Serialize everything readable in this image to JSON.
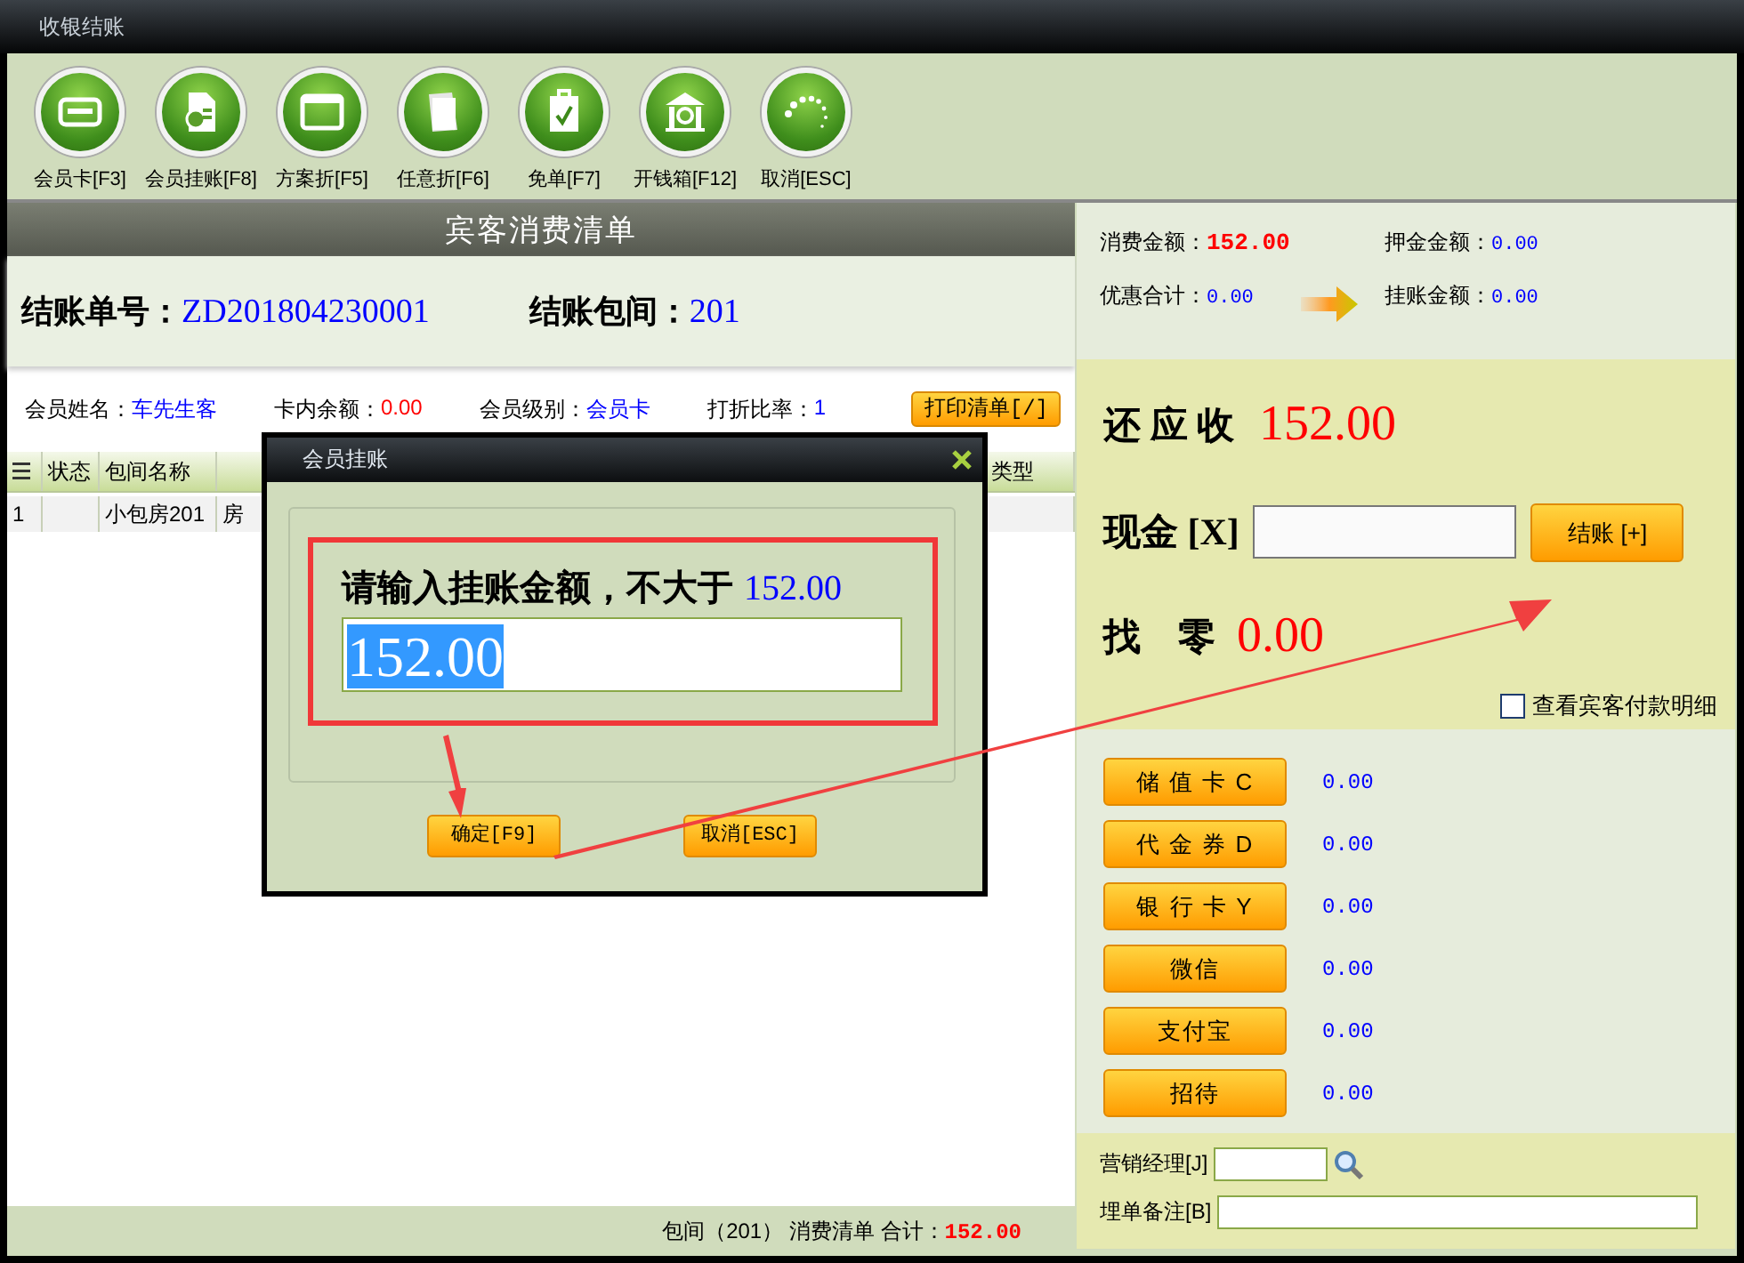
{
  "window": {
    "title": "收银结账"
  },
  "toolbar": [
    {
      "label": "会员卡[F3]",
      "kind": "card"
    },
    {
      "label": "会员挂账[F8]",
      "kind": "document"
    },
    {
      "label": "方案折[F5]",
      "kind": "window"
    },
    {
      "label": "任意折[F6]",
      "kind": "papers"
    },
    {
      "label": "免单[F7]",
      "kind": "clipboard"
    },
    {
      "label": "开钱箱[F12]",
      "kind": "building"
    },
    {
      "label": "取消[ESC]",
      "kind": "dots"
    }
  ],
  "bill": {
    "title": "宾客消费清单",
    "number_label": "结账单号：",
    "number": "ZD201804230001",
    "room_label": "结账包间：",
    "room": "201",
    "member": [
      {
        "label": "会员姓名：",
        "value": "车先生客",
        "color": "#0000ff"
      },
      {
        "label": "卡内余额：",
        "value": "0.00",
        "color": "#ff0000"
      },
      {
        "label": "会员级别：",
        "value": "会员卡",
        "color": "#0000ff"
      },
      {
        "label": "打折比率：",
        "value": "1",
        "color": "#0000ff"
      }
    ],
    "print_button": "打印清单[/]",
    "table": {
      "columns": [
        {
          "label": "状态"
        },
        {
          "label": "包间名称"
        },
        {
          "label": "类型"
        }
      ],
      "rows": [
        {
          "number": "1",
          "room_name": "小包房201",
          "column_4": "房"
        }
      ]
    },
    "footer": {
      "text": "包间（201） 消费清单 合计：",
      "total": "152.00"
    }
  },
  "summary": [
    {
      "label": "消费金额：",
      "value": "152.00",
      "color": "#ff0000"
    },
    {
      "label": "押金金额：",
      "value": "0.00",
      "color": "#0000ff"
    },
    {
      "label": "优惠合计：",
      "value": "0.00",
      "color": "#0000ff"
    },
    {
      "label": "挂账金额：",
      "value": "0.00",
      "color": "#0000ff"
    }
  ],
  "due": {
    "label": "还 应 收",
    "value": "152.00"
  },
  "cash": {
    "label": "现金 [X]",
    "button": "结账 [+]"
  },
  "change": {
    "label": "找    零",
    "value": "0.00"
  },
  "detail_checkbox": {
    "label": "查看宾客付款明细",
    "checked": false
  },
  "payments": [
    {
      "label": "储 值 卡 C",
      "value": "0.00"
    },
    {
      "label": "代 金 券 D",
      "value": "0.00"
    },
    {
      "label": "银 行 卡 Y",
      "value": "0.00"
    },
    {
      "label": "微信",
      "value": "0.00"
    },
    {
      "label": "支付宝",
      "value": "0.00"
    },
    {
      "label": "招待",
      "value": "0.00"
    }
  ],
  "manager": {
    "label": "营销经理[J]"
  },
  "remark": {
    "label": "埋单备注[B]"
  },
  "dialog": {
    "title": "会员挂账",
    "prompt": "请输入挂账金额，不大于",
    "limit": "152.00",
    "value": "152.00",
    "buttons": [
      {
        "label": "确定[F9]"
      },
      {
        "label": "取消[ESC]"
      }
    ]
  }
}
